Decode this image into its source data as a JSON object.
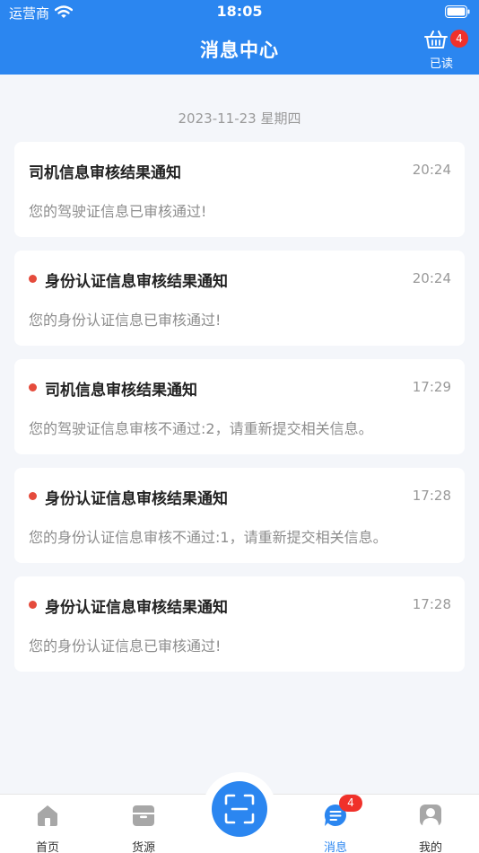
{
  "status_bar": {
    "carrier": "运营商",
    "time": "18:05"
  },
  "header": {
    "title": "消息中心",
    "mark_read_label": "已读",
    "mark_read_badge": "4",
    "bg_color": "#2b86f0"
  },
  "date_label": "2023-11-23   星期四",
  "messages": [
    {
      "title": "司机信息审核结果通知",
      "time": "20:24",
      "content": "您的驾驶证信息已审核通过!",
      "unread": false
    },
    {
      "title": "身份认证信息审核结果通知",
      "time": "20:24",
      "content": "您的身份认证信息已审核通过!",
      "unread": true
    },
    {
      "title": "司机信息审核结果通知",
      "time": "17:29",
      "content": "您的驾驶证信息审核不通过:2，请重新提交相关信息。",
      "unread": true
    },
    {
      "title": "身份认证信息审核结果通知",
      "time": "17:28",
      "content": "您的身份认证信息审核不通过:1，请重新提交相关信息。",
      "unread": true
    },
    {
      "title": "身份认证信息审核结果通知",
      "time": "17:28",
      "content": "您的身份认证信息已审核通过!",
      "unread": true
    }
  ],
  "tabbar": {
    "tabs": [
      {
        "label": "首页",
        "icon": "home-icon",
        "active": false
      },
      {
        "label": "货源",
        "icon": "box-icon",
        "active": false
      },
      {
        "label": "消息",
        "icon": "message-icon",
        "active": true,
        "badge": "4"
      },
      {
        "label": "我的",
        "icon": "user-icon",
        "active": false
      }
    ],
    "center_icon": "scan-icon",
    "active_color": "#2b86f0",
    "unread_dot_color": "#e54b3c"
  }
}
